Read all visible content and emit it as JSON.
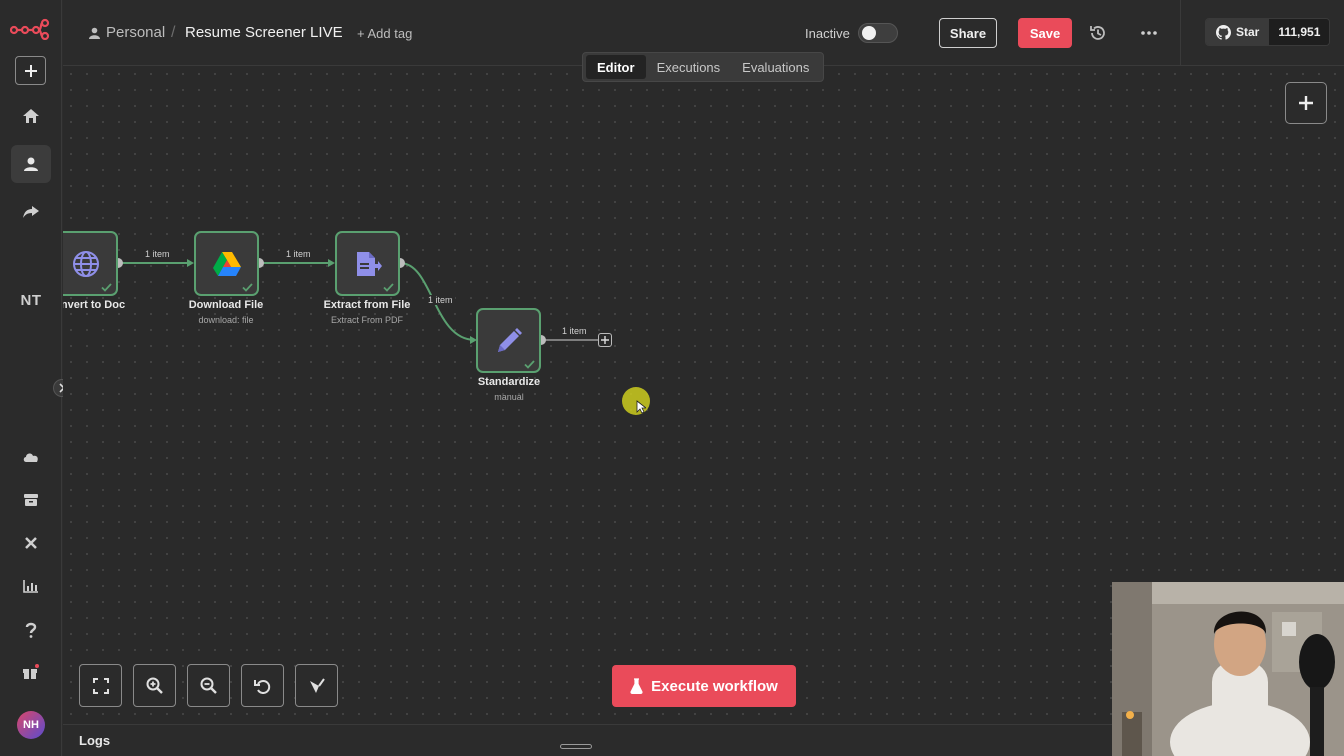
{
  "sidebar": {
    "nt_label": "NT",
    "avatar_initials": "NH"
  },
  "header": {
    "breadcrumb_project": "Personal",
    "breadcrumb_separator": "/",
    "workflow_title": "Resume Screener LIVE",
    "add_tag": "+ Add tag",
    "status_label": "Inactive",
    "share_label": "Share",
    "save_label": "Save",
    "github_star_label": "Star",
    "github_star_count": "111,951"
  },
  "tabs": [
    {
      "label": "Editor",
      "active": true
    },
    {
      "label": "Executions",
      "active": false
    },
    {
      "label": "Evaluations",
      "active": false
    }
  ],
  "nodes": [
    {
      "label": "nvert to Doc",
      "subtitle": "",
      "icon": "globe-icon"
    },
    {
      "label": "Download File",
      "subtitle": "download: file",
      "icon": "google-drive-icon"
    },
    {
      "label": "Extract from File",
      "subtitle": "Extract From PDF",
      "icon": "file-extract-icon"
    },
    {
      "label": "Standardize",
      "subtitle": "manual",
      "icon": "pencil-icon"
    }
  ],
  "edges": [
    {
      "label": "1 item"
    },
    {
      "label": "1 item"
    },
    {
      "label": "1 item"
    },
    {
      "label": "1 item"
    }
  ],
  "execute_label": "Execute workflow",
  "logs_label": "Logs",
  "colors": {
    "accent": "#ea4b5a",
    "node_success_border": "#5aa070",
    "background": "#2a2a2a"
  }
}
